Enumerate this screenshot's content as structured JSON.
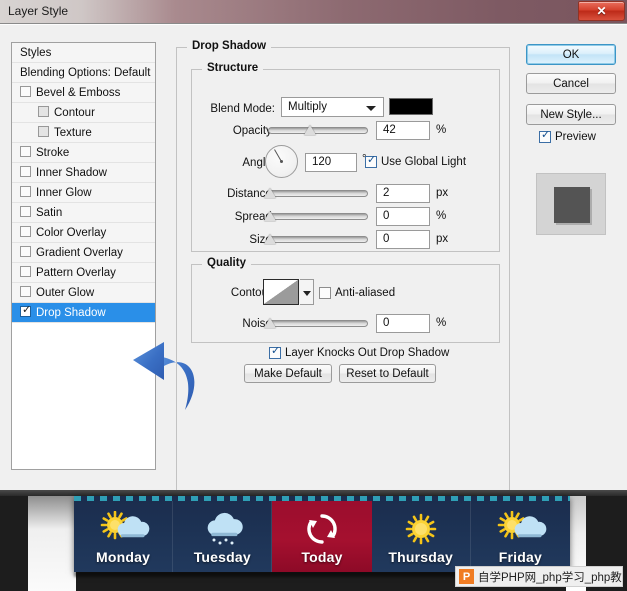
{
  "window": {
    "title": "Layer Style",
    "close_label": "✕"
  },
  "styles_panel": {
    "header": "Styles",
    "blending_options": "Blending Options: Default",
    "items": [
      {
        "label": "Bevel & Emboss",
        "checked": false,
        "indent": false,
        "selected": false
      },
      {
        "label": "Contour",
        "checked": false,
        "indent": true,
        "selected": false
      },
      {
        "label": "Texture",
        "checked": false,
        "indent": true,
        "selected": false
      },
      {
        "label": "Stroke",
        "checked": false,
        "indent": false,
        "selected": false
      },
      {
        "label": "Inner Shadow",
        "checked": false,
        "indent": false,
        "selected": false
      },
      {
        "label": "Inner Glow",
        "checked": false,
        "indent": false,
        "selected": false
      },
      {
        "label": "Satin",
        "checked": false,
        "indent": false,
        "selected": false
      },
      {
        "label": "Color Overlay",
        "checked": false,
        "indent": false,
        "selected": false
      },
      {
        "label": "Gradient Overlay",
        "checked": false,
        "indent": false,
        "selected": false
      },
      {
        "label": "Pattern Overlay",
        "checked": false,
        "indent": false,
        "selected": false
      },
      {
        "label": "Outer Glow",
        "checked": false,
        "indent": false,
        "selected": false
      },
      {
        "label": "Drop Shadow",
        "checked": true,
        "indent": false,
        "selected": true
      }
    ]
  },
  "drop_shadow": {
    "group_title": "Drop Shadow",
    "structure": {
      "title": "Structure",
      "blend_mode_label": "Blend Mode:",
      "blend_mode_value": "Multiply",
      "shadow_color": "#000000",
      "opacity_label": "Opacity:",
      "opacity_value": "42",
      "opacity_unit": "%",
      "angle_label": "Angle:",
      "angle_value": "120",
      "angle_unit": "°",
      "use_global_light_label": "Use Global Light",
      "use_global_light_checked": true,
      "distance_label": "Distance:",
      "distance_value": "2",
      "distance_unit": "px",
      "spread_label": "Spread:",
      "spread_value": "0",
      "spread_unit": "%",
      "size_label": "Size:",
      "size_value": "0",
      "size_unit": "px"
    },
    "quality": {
      "title": "Quality",
      "contour_label": "Contour:",
      "anti_aliased_label": "Anti-aliased",
      "anti_aliased_checked": false,
      "noise_label": "Noise:",
      "noise_value": "0",
      "noise_unit": "%"
    },
    "knocks_out_label": "Layer Knocks Out Drop Shadow",
    "knocks_out_checked": true,
    "make_default_label": "Make Default",
    "reset_default_label": "Reset to Default"
  },
  "actions": {
    "ok_label": "OK",
    "cancel_label": "Cancel",
    "new_style_label": "New Style...",
    "preview_label": "Preview",
    "preview_checked": true,
    "accent_blue": "#2a8fe8"
  },
  "weather_widget": {
    "days": [
      {
        "name": "Monday",
        "icon": "sun-cloud-icon",
        "today": false
      },
      {
        "name": "Tuesday",
        "icon": "cloud-snow-icon",
        "today": false
      },
      {
        "name": "Today",
        "icon": "refresh-icon",
        "today": true
      },
      {
        "name": "Thursday",
        "icon": "sun-icon",
        "today": false
      },
      {
        "name": "Friday",
        "icon": "sun-cloud-icon",
        "today": false
      }
    ],
    "today_bg": "#9b0d2e",
    "panel_bg": "#1d3355"
  },
  "watermark": {
    "logo_letter": "P",
    "text": "自学PHP网_php学习_php教"
  }
}
